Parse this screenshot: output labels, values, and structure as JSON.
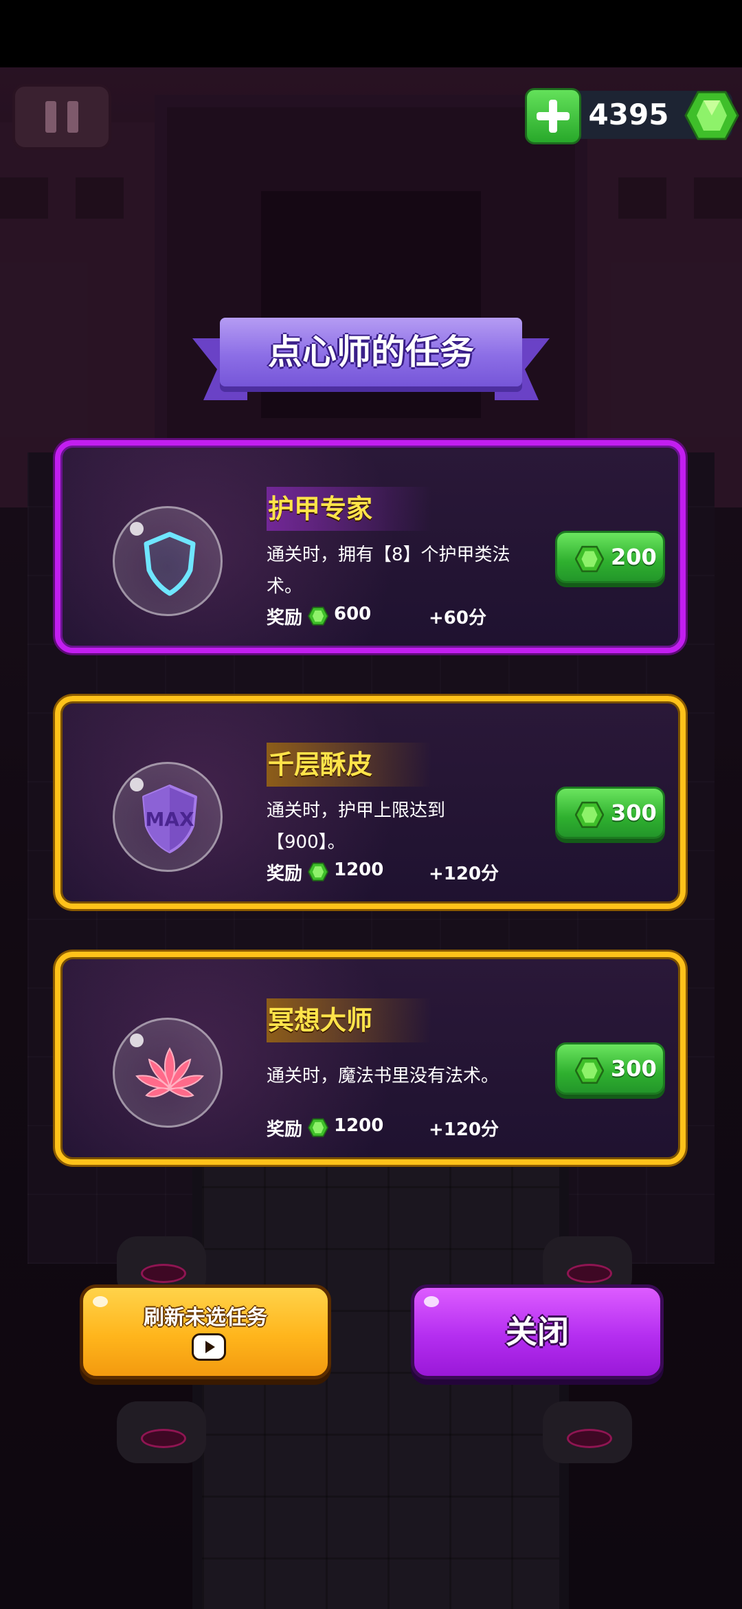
{
  "hud": {
    "gem_count": "4395"
  },
  "title": "点心师的任务",
  "quests": [
    {
      "title": "护甲专家",
      "description": "通关时，拥有【8】个护甲类法术。",
      "reward_label": "奖励",
      "reward_value": "600",
      "score": "+60分",
      "cost": "200",
      "icon": "shield-icon",
      "frame": "purple"
    },
    {
      "title": "千层酥皮",
      "description": "通关时，护甲上限达到【900】。",
      "reward_label": "奖励",
      "reward_value": "1200",
      "score": "+120分",
      "cost": "300",
      "icon": "max-shield-icon",
      "icon_text": "MAX",
      "frame": "gold"
    },
    {
      "title": "冥想大师",
      "description": "通关时，魔法书里没有法术。",
      "reward_label": "奖励",
      "reward_value": "1200",
      "score": "+120分",
      "cost": "300",
      "icon": "lotus-icon",
      "frame": "gold"
    }
  ],
  "buttons": {
    "refresh_label": "刷新未选任务",
    "close_label": "关闭"
  },
  "colors": {
    "gem_green": "#4fd63f",
    "frame_purple": "#c21ef0",
    "frame_gold": "#ffc21a",
    "title_yellow": "#ffe44a",
    "refresh_orange": "#ffb51c",
    "close_purple": "#b42ef0"
  }
}
